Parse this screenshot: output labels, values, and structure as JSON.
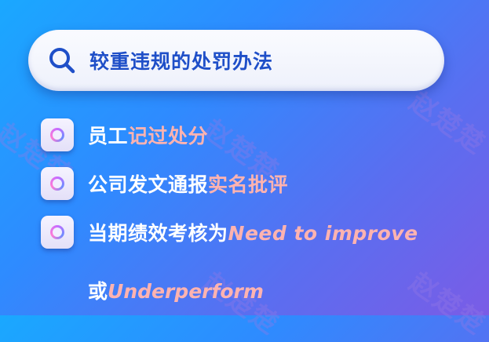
{
  "search": {
    "title": "较重违规的处罚办法"
  },
  "items": [
    {
      "prefix": "员工",
      "highlight": "记过处分",
      "suffix": ""
    },
    {
      "prefix": "公司发文通报",
      "highlight": "实名批评",
      "suffix": ""
    },
    {
      "prefix": "当期绩效考核为",
      "highlight": "Need to improve",
      "suffix": ""
    }
  ],
  "continuation": {
    "prefix": "或",
    "highlight": "Underperform"
  },
  "watermark": {
    "text": "赵楚楚"
  },
  "colors": {
    "accent": "#1f4fc8",
    "highlight": "#ffb3b0",
    "text": "#ffffff"
  }
}
